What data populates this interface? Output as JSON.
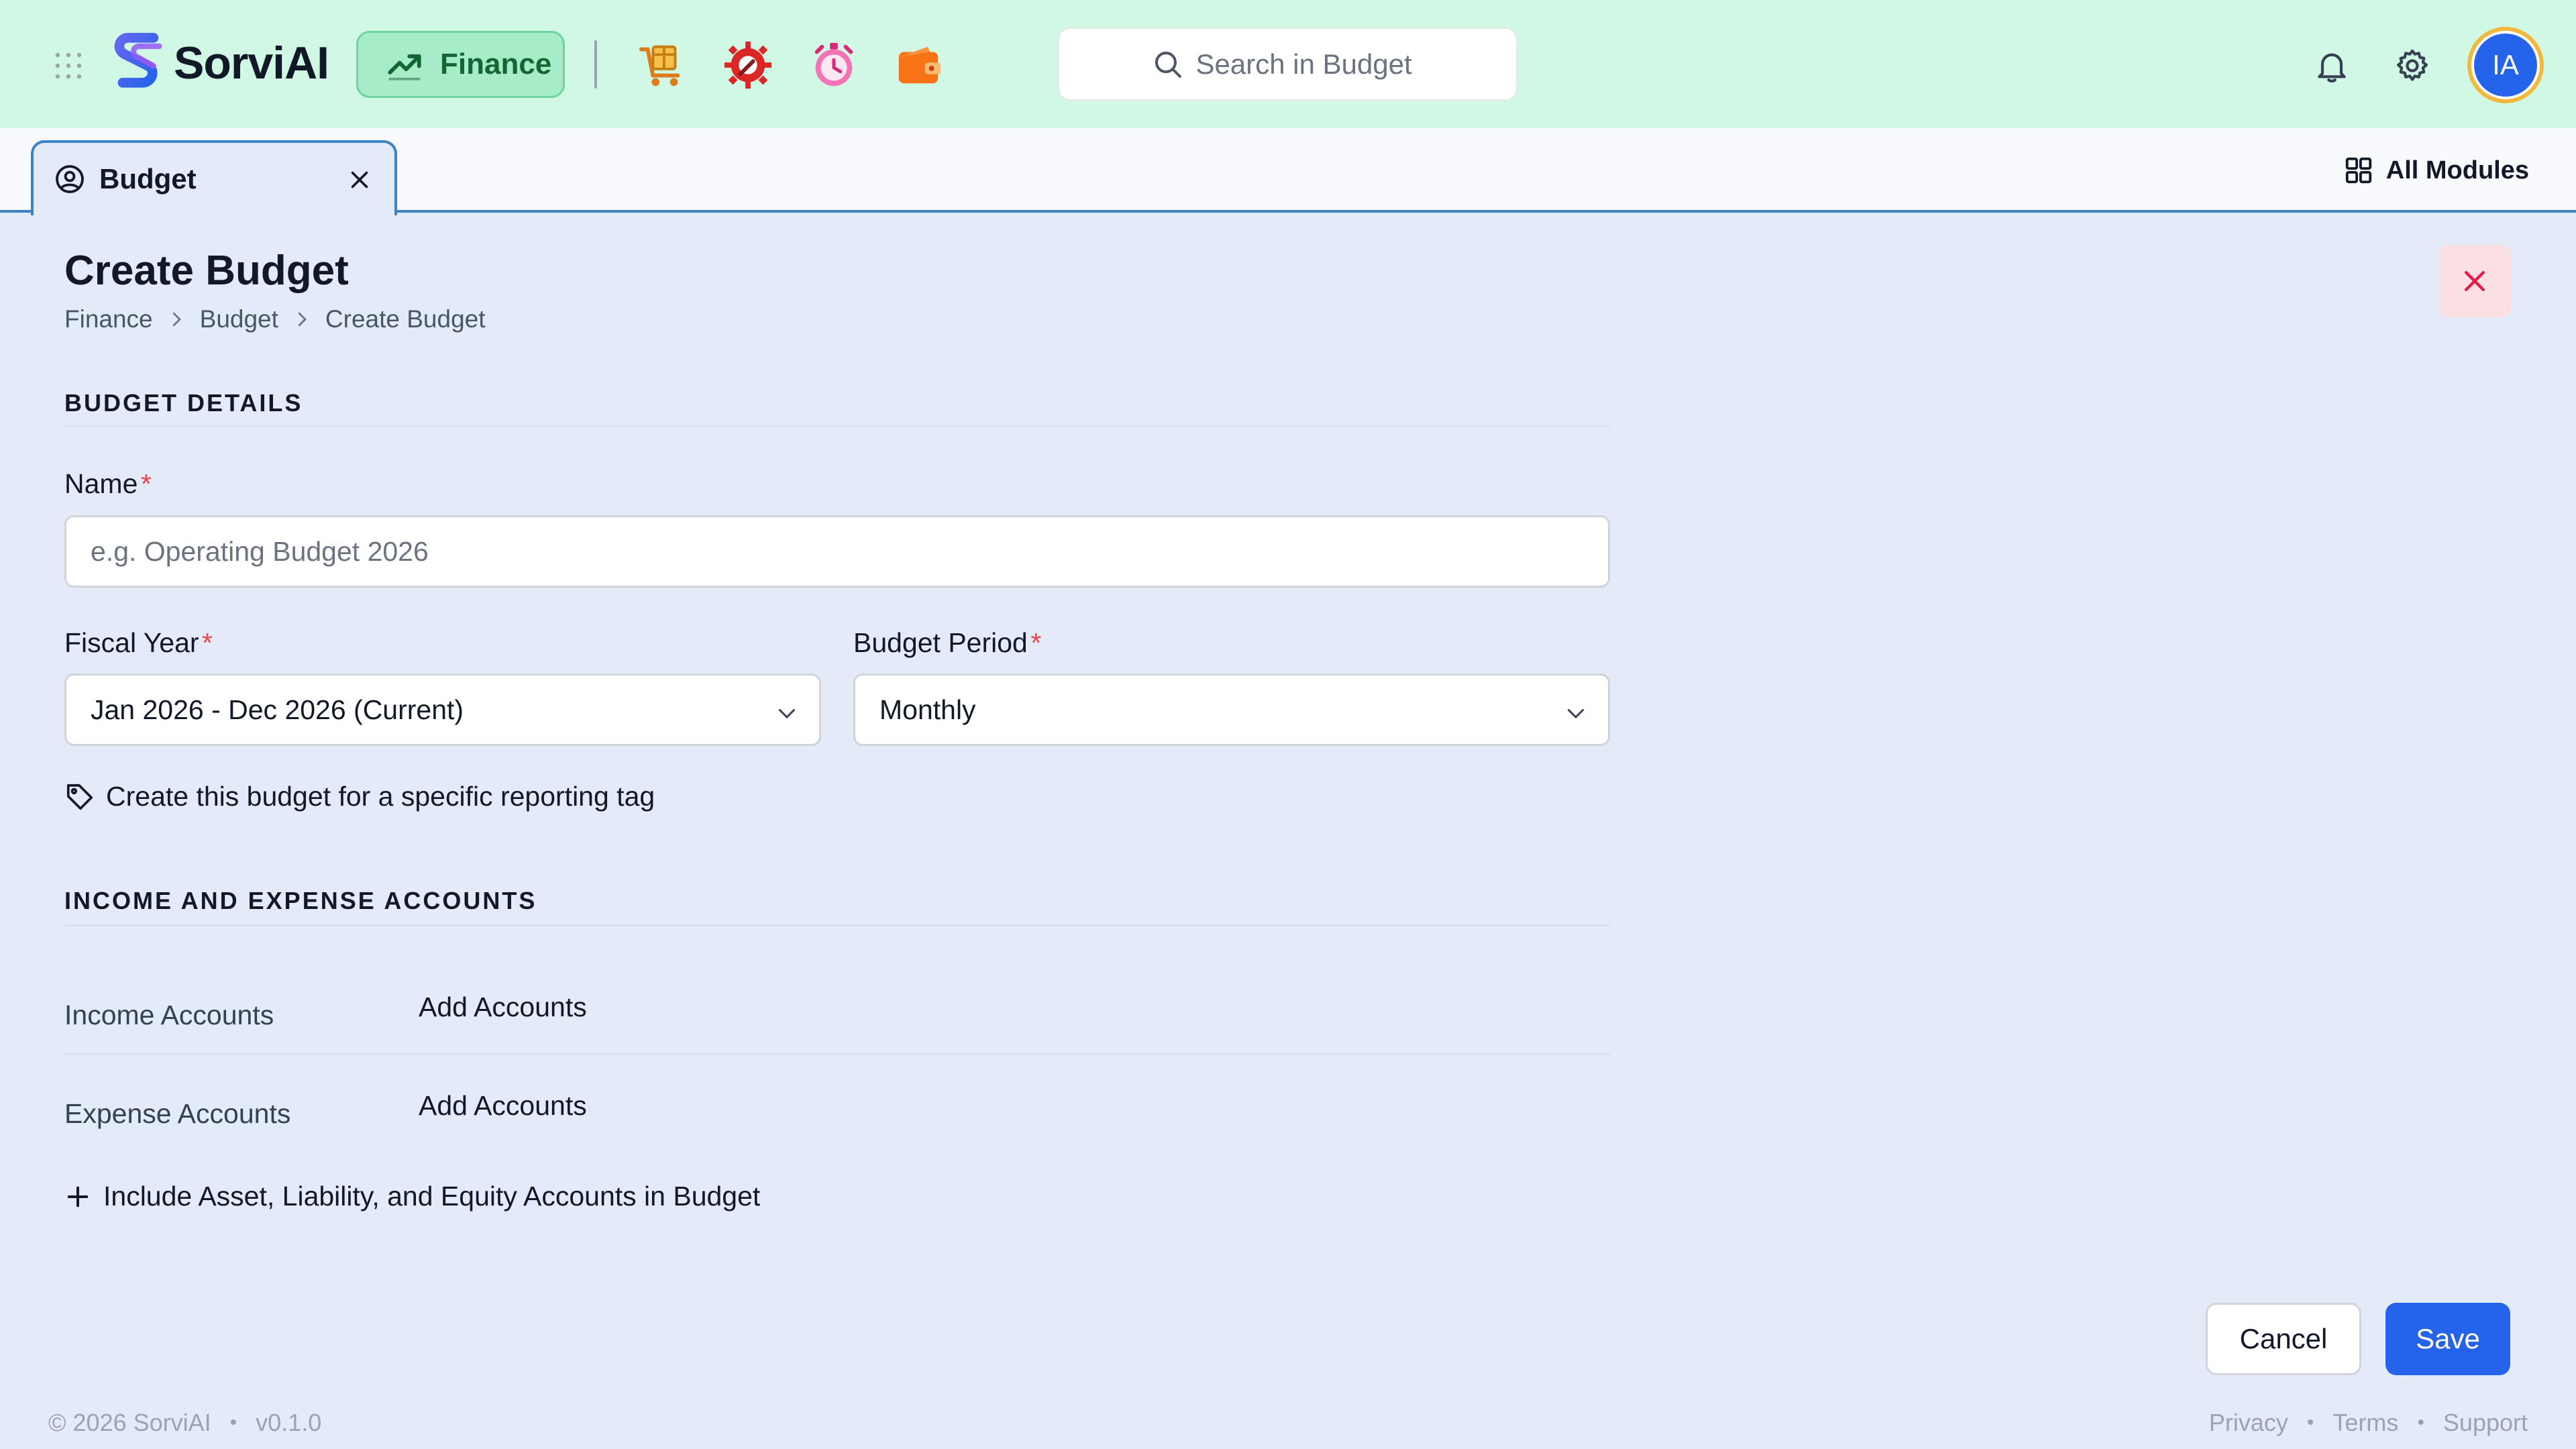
{
  "brand": {
    "name": "SorviAI"
  },
  "topbar": {
    "module_label": "Finance",
    "search_placeholder": "Search in Budget",
    "avatar_initials": "IA",
    "app_icons": [
      "inventory-cart-icon",
      "service-gear-icon",
      "time-tracker-icon",
      "wallet-icon"
    ]
  },
  "tabs": {
    "active_label": "Budget",
    "all_modules_label": "All Modules"
  },
  "page": {
    "title": "Create Budget",
    "breadcrumb": [
      "Finance",
      "Budget",
      "Create Budget"
    ]
  },
  "form": {
    "section_details": "BUDGET DETAILS",
    "name_label": "Name",
    "name_placeholder": "e.g. Operating Budget 2026",
    "fiscal_year_label": "Fiscal Year",
    "fiscal_year_value": "Jan 2026 - Dec 2026 (Current)",
    "period_label": "Budget Period",
    "period_value": "Monthly",
    "required_mark": "*",
    "reporting_tag_link": "Create this budget for a specific reporting tag",
    "section_accounts": "INCOME AND EXPENSE ACCOUNTS",
    "income_label": "Income Accounts",
    "expense_label": "Expense Accounts",
    "add_accounts": "Add Accounts",
    "include_link": "Include Asset, Liability, and Equity Accounts in Budget"
  },
  "actions": {
    "cancel": "Cancel",
    "save": "Save"
  },
  "footer": {
    "copyright": "© 2026 SorviAI",
    "version": "v0.1.0",
    "links": [
      "Privacy",
      "Terms",
      "Support"
    ]
  },
  "colors": {
    "topbar_bg": "#d0f8e4",
    "page_bg": "#e3ebf9",
    "accent": "#2563eb",
    "required": "#ef4444",
    "module_pill": "#a6ecc9"
  }
}
